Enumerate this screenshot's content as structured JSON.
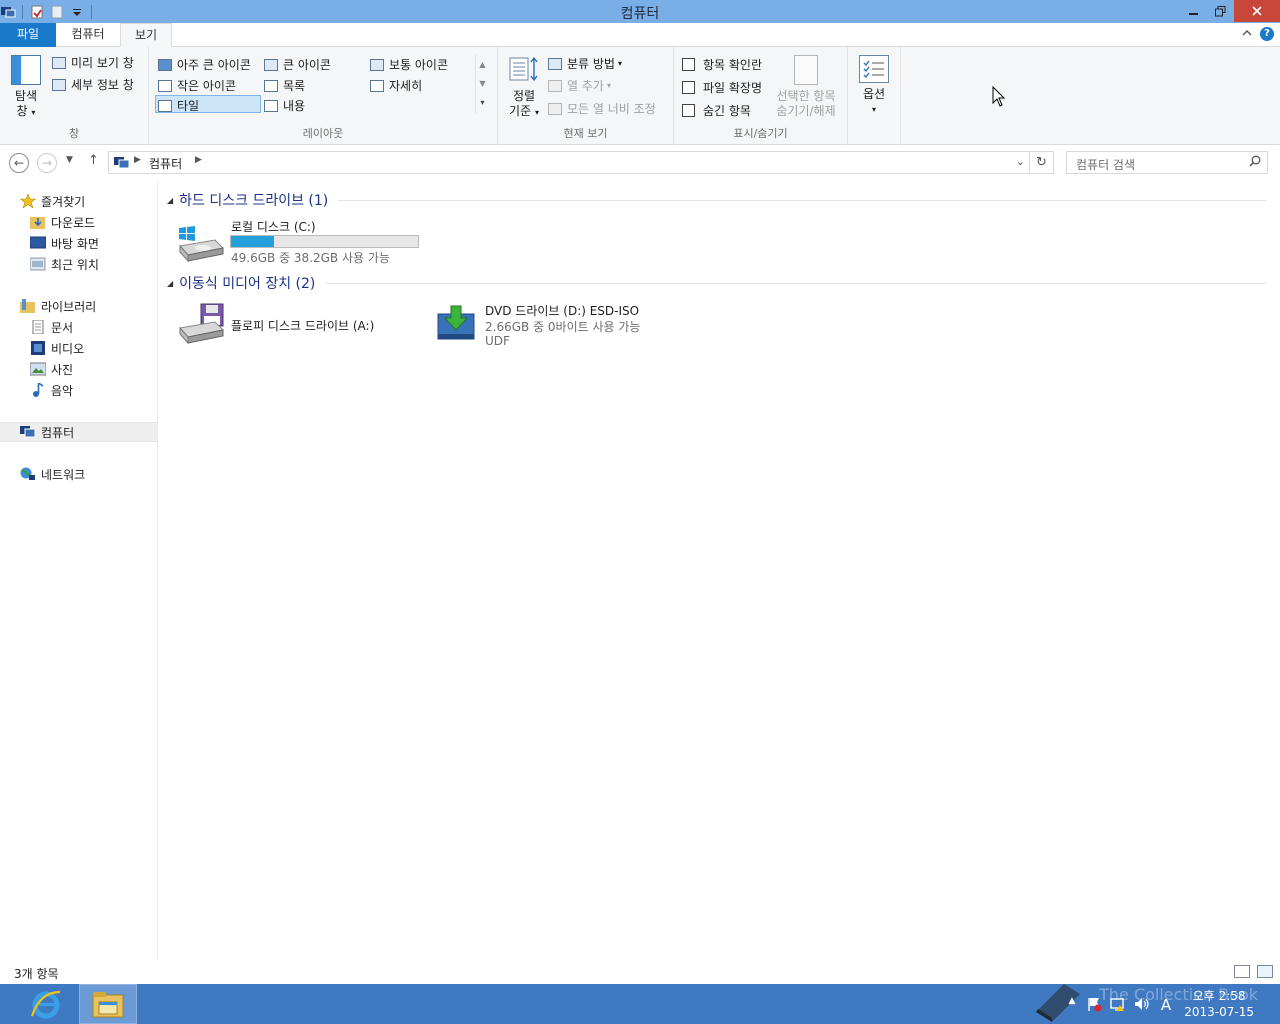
{
  "window": {
    "title": "컴퓨터"
  },
  "ribbon": {
    "tabs": {
      "file": "파일",
      "computer": "컴퓨터",
      "view": "보기"
    },
    "panes": {
      "nav_pane": [
        "탐색",
        "창"
      ],
      "preview_pane": "미리 보기 창",
      "details_pane": "세부 정보 창",
      "label": "창"
    },
    "layout": {
      "extra_large_icons": "아주 큰 아이콘",
      "large_icons": "큰 아이콘",
      "medium_icons": "보통 아이콘",
      "small_icons": "작은 아이콘",
      "list": "목록",
      "details": "자세히",
      "tiles": "타일",
      "content": "내용",
      "label": "레이아웃"
    },
    "current_view": {
      "sort_by": [
        "정렬",
        "기준"
      ],
      "group_by": "분류 방법",
      "add_columns": "열 추가",
      "size_columns": "모든 열 너비 조정",
      "label": "현재 보기"
    },
    "show_hide": {
      "item_checkboxes": "항목 확인란",
      "file_extensions": "파일 확장명",
      "hidden_items": "숨긴 항목",
      "hide_selected": [
        "선택한 항목",
        "숨기기/해제"
      ],
      "label": "표시/숨기기"
    },
    "options": "옵션"
  },
  "address": {
    "crumb": "컴퓨터",
    "search_placeholder": "컴퓨터 검색"
  },
  "nav_pane": {
    "favorites": "즐겨찾기",
    "downloads": "다운로드",
    "desktop": "바탕 화면",
    "recent": "최근 위치",
    "libraries": "라이브러리",
    "documents": "문서",
    "videos": "비디오",
    "pictures": "사진",
    "music": "음악",
    "computer": "컴퓨터",
    "network": "네트워크"
  },
  "content": {
    "hdd_section": "하드 디스크 드라이브 (1)",
    "removable_section": "이동식 미디어 장치 (2)",
    "drive_c": {
      "name": "로컬 디스크 (C:)",
      "space": "49.6GB 중 38.2GB 사용 가능",
      "used_fraction": 0.23
    },
    "drive_a": {
      "name": "플로피 디스크 드라이브 (A:)"
    },
    "drive_d": {
      "name": "DVD 드라이브 (D:) ESD-ISO",
      "space": "2.66GB 중 0바이트 사용 가능",
      "fs": "UDF"
    }
  },
  "status": {
    "item_count": "3개 항목"
  },
  "taskbar": {
    "time": "오후 2:58",
    "date": "2013-07-15",
    "ime": "A",
    "watermark": "The Collection Book"
  },
  "colors": {
    "titlebar": "#7aaee6",
    "file_tab": "#1979ca",
    "taskbar": "#3e79c2",
    "progress": "#26a0da",
    "section_header": "#1e3287"
  }
}
